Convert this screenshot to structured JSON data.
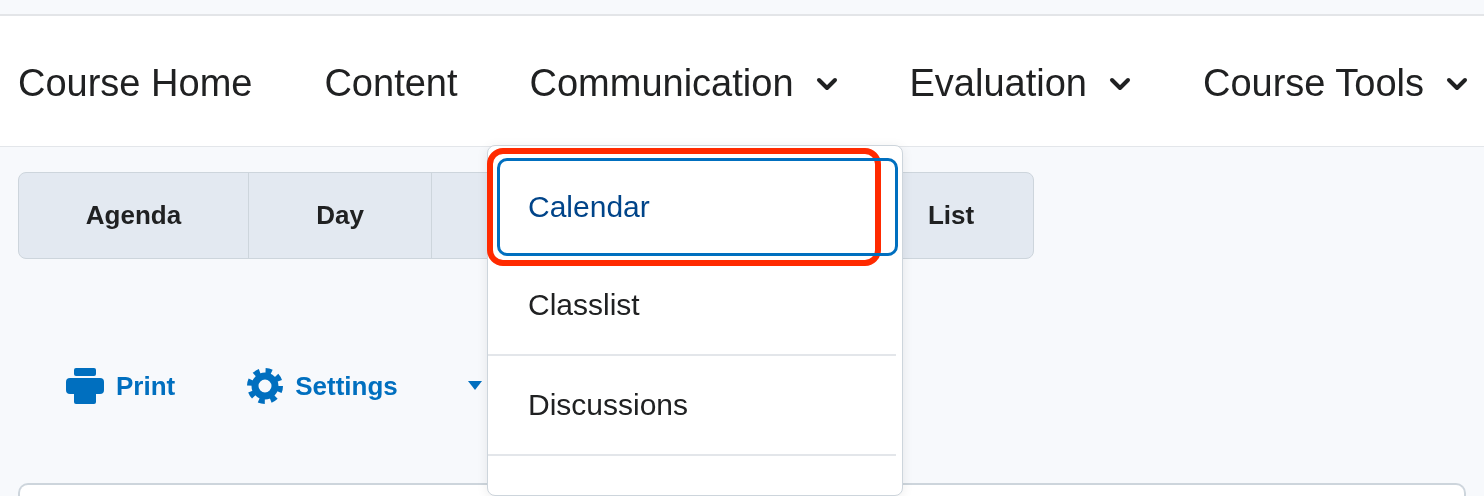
{
  "nav": [
    {
      "label": "Course Home",
      "has_menu": false
    },
    {
      "label": "Content",
      "has_menu": false
    },
    {
      "label": "Communication",
      "has_menu": true
    },
    {
      "label": "Evaluation",
      "has_menu": true
    },
    {
      "label": "Course Tools",
      "has_menu": true
    }
  ],
  "view_tabs": [
    {
      "label": "Agenda",
      "selected": false
    },
    {
      "label": "Day",
      "selected": false
    },
    {
      "label": "List",
      "selected": false
    }
  ],
  "toolbar": [
    {
      "label": "Print",
      "kind": "print"
    },
    {
      "label": "Settings",
      "kind": "settings"
    }
  ],
  "menu": {
    "items": [
      {
        "label": "Calendar",
        "focused": true,
        "highlighted": true
      },
      {
        "label": "Classlist",
        "focused": false,
        "highlighted": false
      },
      {
        "label": "Discussions",
        "focused": false,
        "highlighted": false
      }
    ]
  }
}
